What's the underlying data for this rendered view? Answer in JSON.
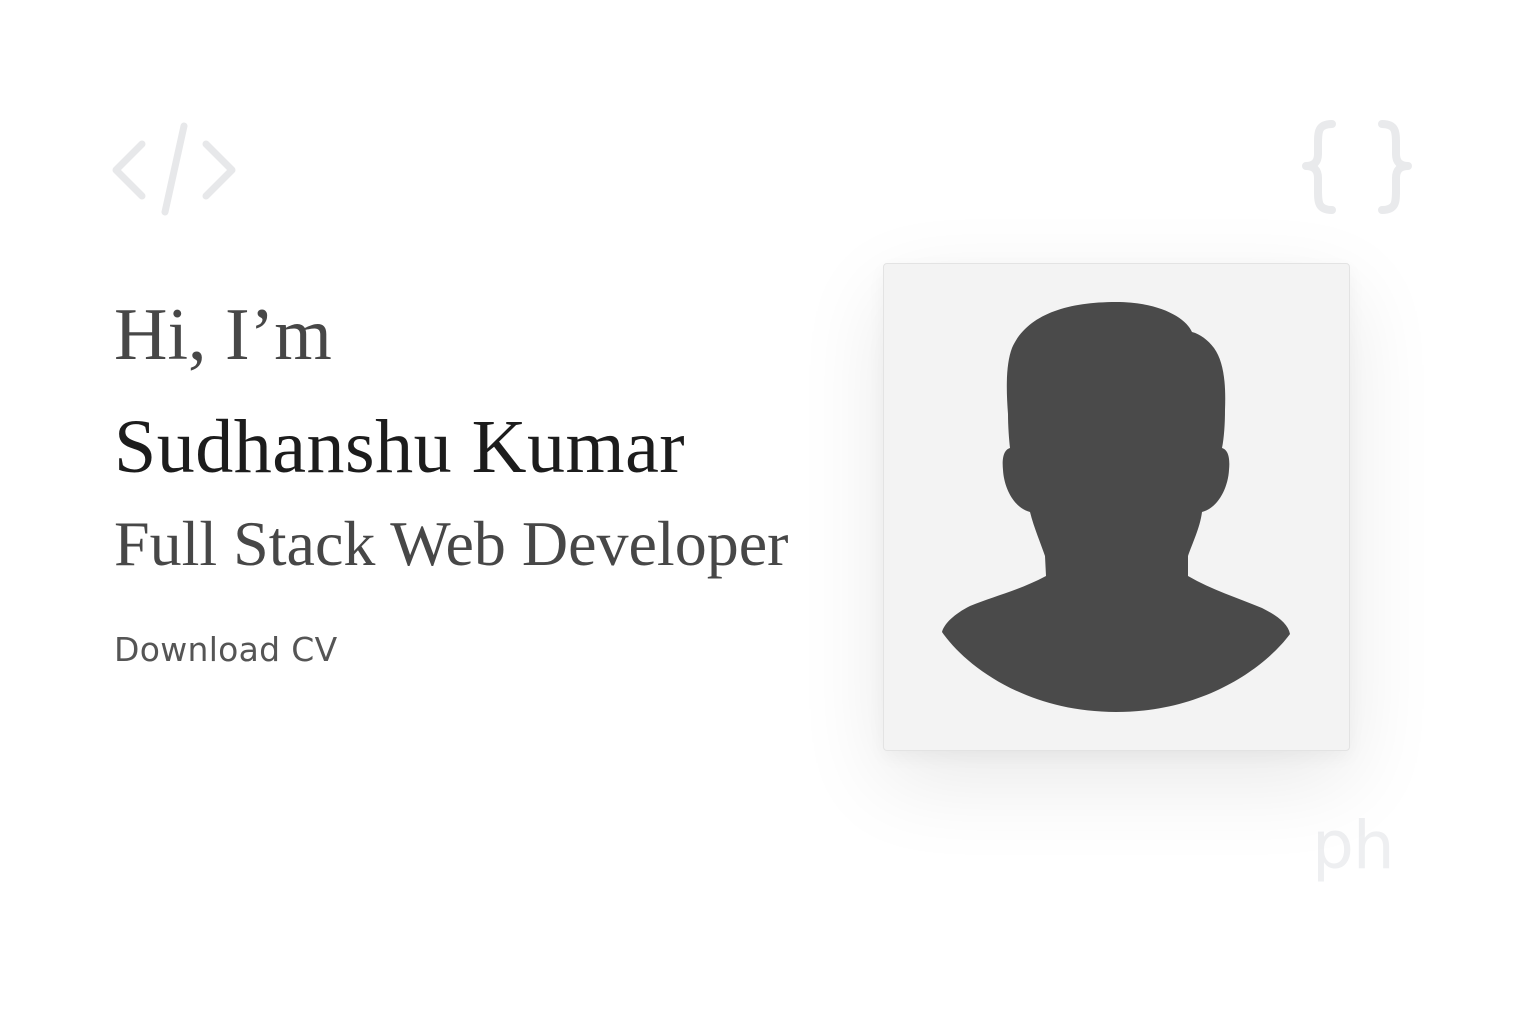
{
  "hero": {
    "greeting": "Hi, I’m",
    "name": "Sudhanshu Kumar",
    "role": "Full Stack Web Developer",
    "cta_label": "Download CV"
  },
  "decorations": {
    "code_tag_icon": "code-tag-icon",
    "braces_icon": "curly-braces-icon",
    "ph_text": "ph"
  },
  "avatar": {
    "icon": "user-silhouette-icon"
  },
  "colors": {
    "background": "#ffffff",
    "heading_text": "#1c1c1c",
    "body_text": "#474747",
    "silhouette": "#4a4a4a",
    "card_background": "#f3f3f3",
    "decoration": "#e9eaec"
  }
}
